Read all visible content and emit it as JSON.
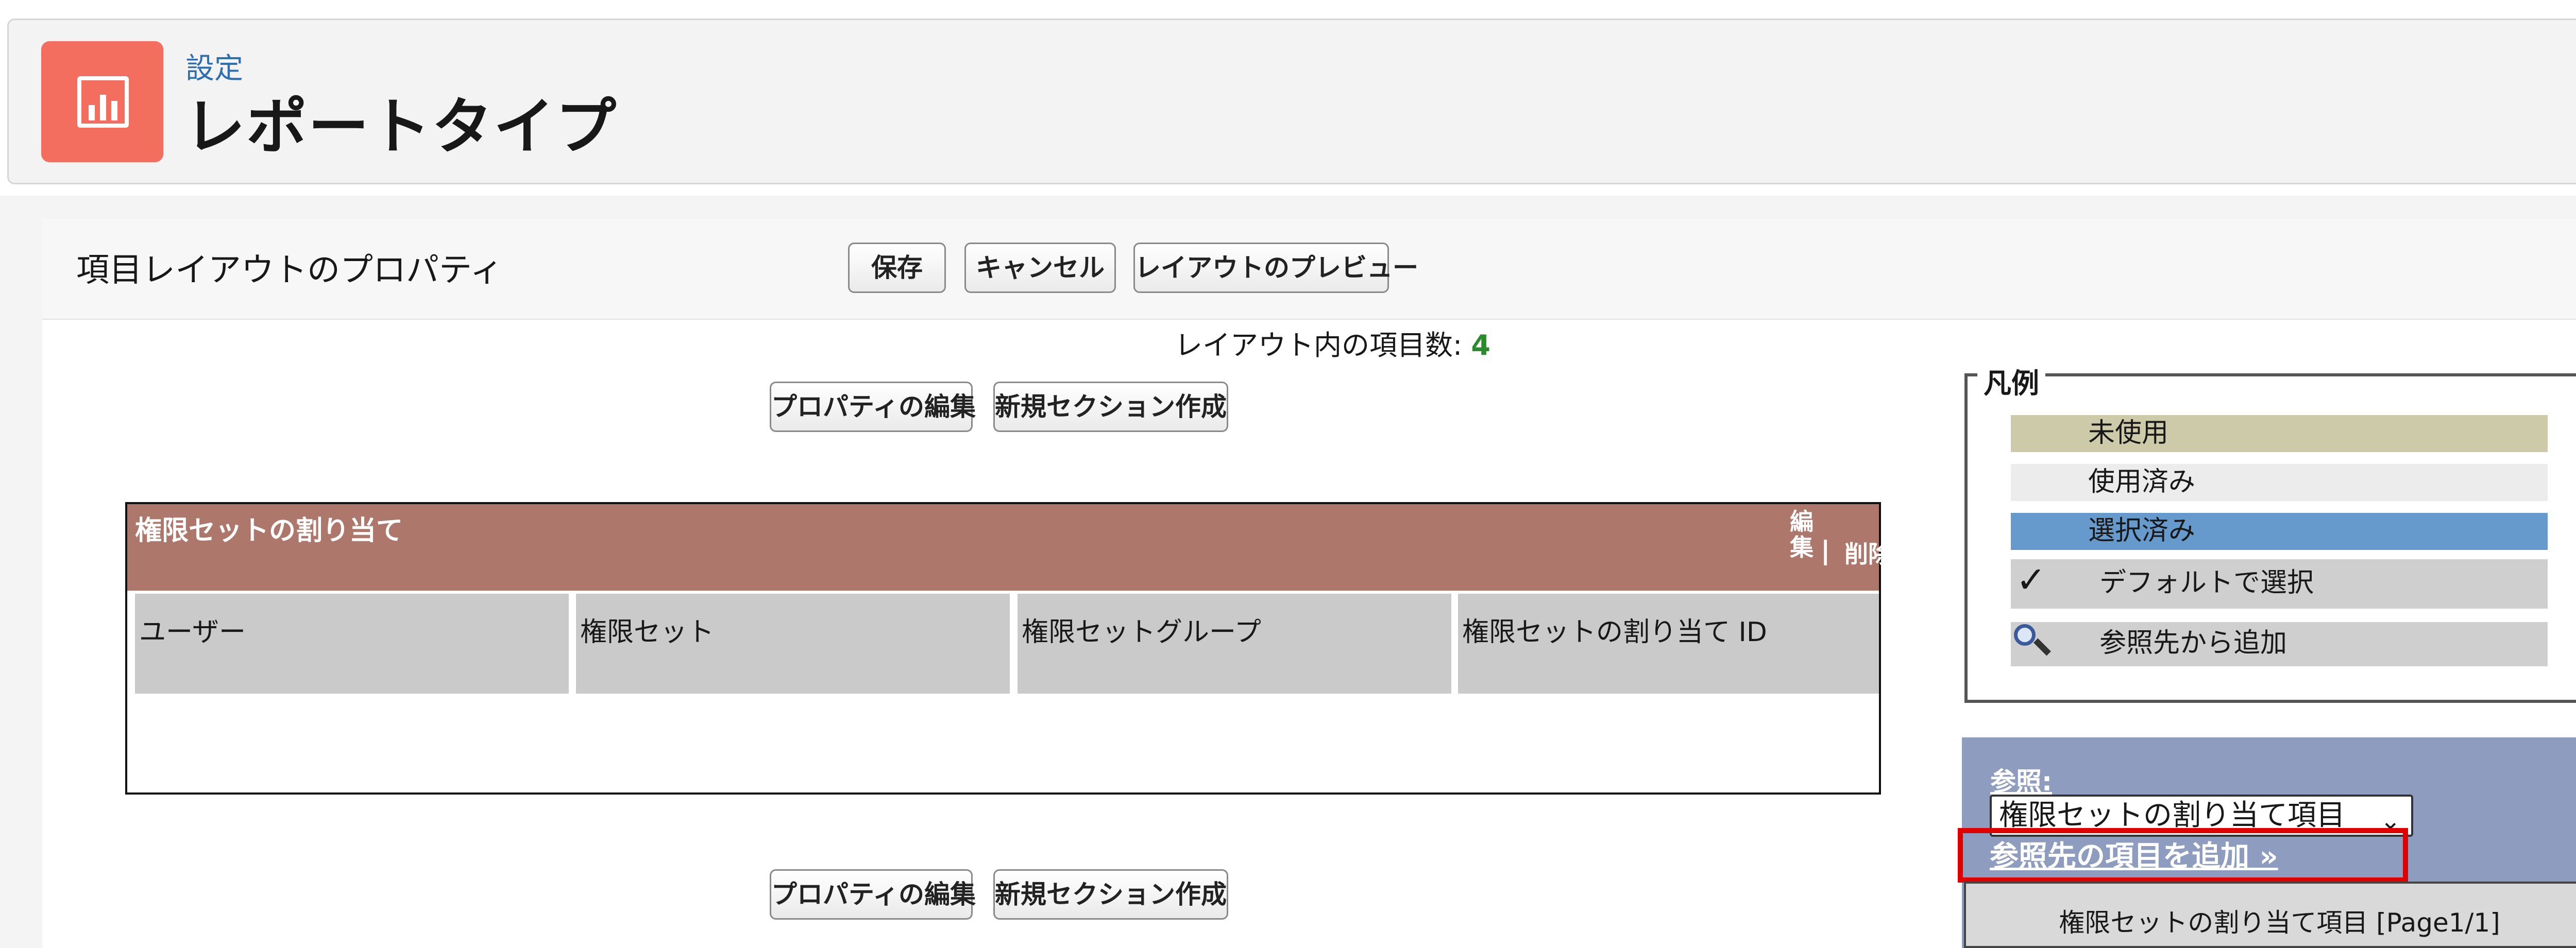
{
  "header": {
    "breadcrumb": "設定",
    "title": "レポートタイプ",
    "icon": "report-icon",
    "icon_color": "#f36e5f"
  },
  "layout_editor": {
    "section_title": "項目レイアウトのプロパティ",
    "buttons": {
      "save": "保存",
      "cancel": "キャンセル",
      "preview": "レイアウトのプレビュー",
      "edit_properties": "プロパティの編集",
      "new_section": "新規セクション作成"
    },
    "field_count_label": "レイアウト内の項目数:",
    "field_count": "4",
    "section": {
      "name": "権限セットの割り当て",
      "edit_label": "編集",
      "separator": "|",
      "delete_label": "削除",
      "header_color": "#ae776b",
      "fields": [
        "ユーザー",
        "権限セット",
        "権限セットグループ",
        "権限セットの割り当て ID"
      ]
    }
  },
  "legend": {
    "title": "凡例",
    "items": [
      {
        "label": "未使用",
        "color": "#cccaa9"
      },
      {
        "label": "使用済み",
        "color": "#ececec"
      },
      {
        "label": "選択済み",
        "color": "#6699cc"
      },
      {
        "label": "デフォルトで選択",
        "color": "#cfcfcf",
        "icon": "check-icon"
      },
      {
        "label": "参照先から追加",
        "color": "#cfcfcf",
        "icon": "magnifier-icon"
      }
    ]
  },
  "lookup": {
    "label": "参照:",
    "selected": "権限セットの割り当て項目",
    "add_link": "参照先の項目を追加 »",
    "list_title": "権限セットの割り当て項目 [Page1/1]"
  }
}
